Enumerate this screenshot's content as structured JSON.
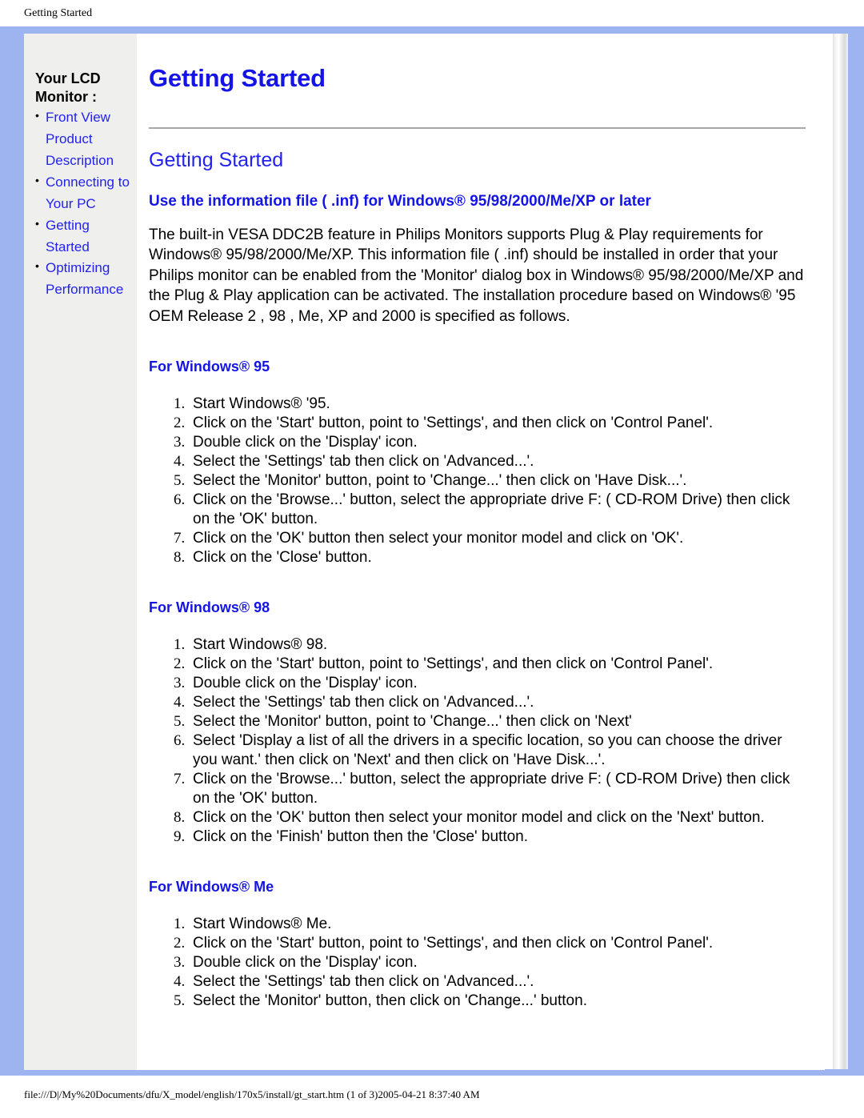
{
  "page_header": {
    "title": "Getting Started"
  },
  "sidebar": {
    "heading": "Your LCD Monitor :",
    "items": [
      {
        "label": "Front View Product Description"
      },
      {
        "label": "Connecting to Your PC"
      },
      {
        "label": "Getting Started"
      },
      {
        "label": "Optimizing Performance"
      }
    ]
  },
  "main": {
    "doc_title": "Getting Started",
    "doc_subtitle": "Getting Started",
    "section_heading": "Use the information file ( .inf) for Windows® 95/98/2000/Me/XP or later",
    "intro_paragraph": "The built-in VESA DDC2B feature in Philips Monitors supports Plug & Play requirements for Windows® 95/98/2000/Me/XP. This information file ( .inf) should be installed in order that your Philips monitor can be enabled from the 'Monitor' dialog box in Windows® 95/98/2000/Me/XP and the Plug & Play application can be activated. The installation procedure based on Windows® '95 OEM Release 2 , 98 , Me, XP and 2000 is specified as follows.",
    "sections": [
      {
        "heading": "For Windows® 95",
        "steps": [
          "Start Windows® '95.",
          "Click on the 'Start' button, point to 'Settings', and then click on 'Control Panel'.",
          "Double click on the 'Display' icon.",
          "Select the 'Settings' tab then click on 'Advanced...'.",
          "Select the 'Monitor' button, point to 'Change...' then click on 'Have Disk...'.",
          "Click on the 'Browse...' button, select the appropriate drive F: ( CD-ROM Drive) then click on the 'OK' button.",
          "Click on the 'OK' button then select your monitor model and click on 'OK'.",
          "Click on the 'Close' button."
        ]
      },
      {
        "heading": "For Windows® 98",
        "steps": [
          "Start Windows® 98.",
          "Click on the 'Start' button, point to 'Settings', and then click on 'Control Panel'.",
          "Double click on the 'Display' icon.",
          "Select the 'Settings' tab then click on 'Advanced...'.",
          "Select the 'Monitor' button, point to 'Change...' then click on 'Next'",
          "Select 'Display a list of all the drivers in a specific location, so you can choose the driver you want.' then click on 'Next' and then click on 'Have Disk...'.",
          "Click on the 'Browse...' button, select the appropriate drive F: ( CD-ROM Drive) then click on the 'OK' button.",
          "Click on the 'OK' button then select your monitor model and click on the 'Next' button.",
          "Click on the 'Finish' button then the 'Close' button."
        ]
      },
      {
        "heading": "For Windows® Me",
        "steps": [
          "Start Windows® Me.",
          "Click on the 'Start' button, point to 'Settings', and then click on 'Control Panel'.",
          "Double click on the 'Display' icon.",
          "Select the 'Settings' tab then click on 'Advanced...'.",
          "Select the 'Monitor' button, then click on 'Change...' button."
        ]
      }
    ]
  },
  "footer": {
    "path": "file:///D|/My%20Documents/dfu/X_model/english/170x5/install/gt_start.htm (1 of 3)2005-04-21 8:37:40 AM"
  },
  "colors": {
    "frame_blue": "#9db4f0",
    "link_blue": "#2222ee",
    "heading_blue": "#1414e6",
    "sidebar_gray": "#efefee",
    "rule_gray": "#a8a8a8"
  }
}
